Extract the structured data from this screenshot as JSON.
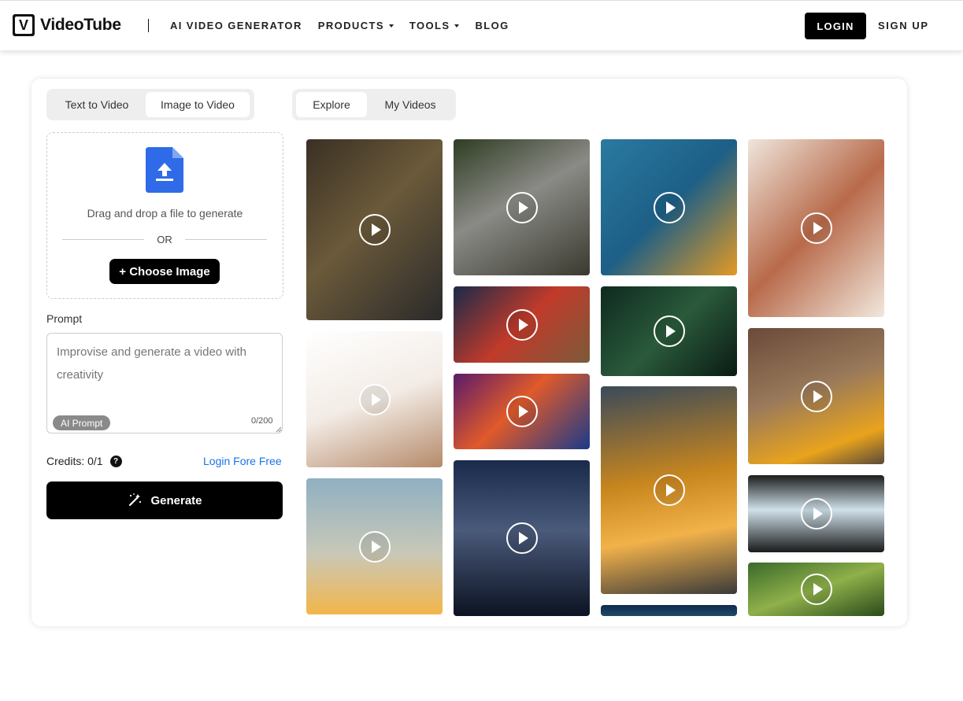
{
  "header": {
    "brand": "VideoTube",
    "nav": [
      {
        "label": "AI VIDEO GENERATOR",
        "dropdown": false
      },
      {
        "label": "PRODUCTS",
        "dropdown": true
      },
      {
        "label": "TOOLS",
        "dropdown": true
      },
      {
        "label": "BLOG",
        "dropdown": false
      }
    ],
    "login": "LOGIN",
    "signup": "SIGN UP"
  },
  "mode_tabs": {
    "text_to_video": "Text to Video",
    "image_to_video": "Image to Video",
    "active": "Image to Video"
  },
  "upload": {
    "drag_text": "Drag and drop a file to generate",
    "or": "OR",
    "choose_button": "+ Choose Image"
  },
  "prompt": {
    "label": "Prompt",
    "placeholder": "Improvise and generate a video with creativity",
    "ai_badge": "AI Prompt",
    "counter": "0/200"
  },
  "credits": {
    "text": "Credits: 0/1",
    "login_link": "Login Fore Free"
  },
  "generate_button": "Generate",
  "view_tabs": {
    "explore": "Explore",
    "my_videos": "My Videos",
    "active": "Explore"
  },
  "colors": {
    "accent": "#1a73e8",
    "button": "#000000",
    "upload_icon": "#2f6be8"
  },
  "gallery": [
    {
      "name": "subway-woman-video",
      "bg": "linear-gradient(135deg,#3a3024 0%,#6b5a3a 45%,#2a2a2a 100%)"
    },
    {
      "name": "robot-kid-video",
      "bg": "linear-gradient(160deg,#ffffff 0%,#f3ece6 50%,#b58a6a 100%)"
    },
    {
      "name": "tightrope-sunset-video",
      "bg": "linear-gradient(180deg,#8fb0c2 0%,#c8c8b8 55%,#f3b64a 100%)"
    },
    {
      "name": "tabby-cat-video",
      "bg": "linear-gradient(150deg,#2f3d22 0%,#8a8a86 45%,#3a3a30 100%)"
    },
    {
      "name": "santa-reindeer-video",
      "bg": "linear-gradient(135deg,#1a2a4a 0%,#c13a2a 50%,#7b5a3a 100%)"
    },
    {
      "name": "christmas-room-video",
      "bg": "linear-gradient(135deg,#5a1a6a 0%,#e05a2a 45%,#1a3a8a 100%)"
    },
    {
      "name": "lightning-ninja-video",
      "bg": "linear-gradient(180deg,#1a2a4a 0%,#4a5a7a 45%,#0c1222 100%)"
    },
    {
      "name": "bird-sculpture-video",
      "bg": "linear-gradient(135deg,#2a7aa0 0%,#1d5f86 50%,#e39a24 100%)"
    },
    {
      "name": "green-flowers-video",
      "bg": "linear-gradient(135deg,#0e2a20 0%,#2a5a3a 50%,#0a1a14 100%)"
    },
    {
      "name": "golden-dress-video",
      "bg": "linear-gradient(170deg,#3a4a5a 0%,#c8861e 45%,#f2b24a 70%,#3a3a3a 100%)"
    },
    {
      "name": "dark-water-video",
      "bg": "linear-gradient(180deg,#0f2a4a 0%,#1d4a6a 100%)"
    },
    {
      "name": "coral-figure-video",
      "bg": "linear-gradient(135deg,#efe6dc 0%,#b86a4a 50%,#f1e8dd 100%)"
    },
    {
      "name": "graffiti-car-video",
      "bg": "linear-gradient(160deg,#6a4a3a 0%,#9a7a5a 45%,#e9a31c 80%,#5a4a3a 100%)"
    },
    {
      "name": "truck-cab-video",
      "bg": "linear-gradient(180deg,#1c1c1c 0%,#cfe1ea 45%,#1a1a1a 100%)"
    },
    {
      "name": "bamboo-fish-video",
      "bg": "linear-gradient(160deg,#3a6a2a 0%,#8fb04a 50%,#2a4a1a 100%)"
    }
  ]
}
